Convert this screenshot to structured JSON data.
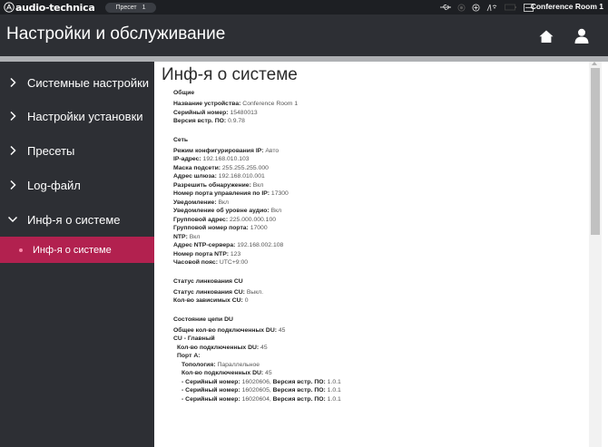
{
  "topbar": {
    "brand": "audio-technica",
    "preset_label": "Пресет",
    "preset_number": "1",
    "room_name": "Conference Room 1",
    "icons": [
      "usb-icon",
      "record-icon",
      "link-icon",
      "antenna-icon",
      "battery-icon",
      "screen-icon"
    ]
  },
  "header": {
    "title": "Настройки и обслуживание"
  },
  "sidebar": {
    "items": [
      {
        "label": "Системные настройки",
        "expanded": false
      },
      {
        "label": "Настройки установки",
        "expanded": false
      },
      {
        "label": "Пресеты",
        "expanded": false
      },
      {
        "label": "Log-файл",
        "expanded": false
      },
      {
        "label": "Инф-я о системе",
        "expanded": true
      }
    ],
    "active_sub": "Инф-я о системе"
  },
  "main": {
    "title": "Инф-я о системе",
    "general": {
      "heading": "Общие",
      "rows": [
        {
          "k": "Название устройства:",
          "v": " Conference Room 1"
        },
        {
          "k": "Серийный номер:",
          "v": " 15480013"
        },
        {
          "k": "Версия встр. ПО:",
          "v": " 0.9.78"
        }
      ]
    },
    "network": {
      "heading": "Сеть",
      "rows": [
        {
          "k": "Режим конфигурирования IP:",
          "v": " Авто"
        },
        {
          "k": "IP-адрес:",
          "v": " 192.168.010.103"
        },
        {
          "k": "Маска подсети:",
          "v": " 255.255.255.000"
        },
        {
          "k": "Адрес шлюза:",
          "v": " 192.168.010.001"
        },
        {
          "k": "Разрешить обнаружение:",
          "v": " Вкл"
        },
        {
          "k": "Номер порта управления по IP:",
          "v": " 17300"
        },
        {
          "k": "Уведомление:",
          "v": " Вкл"
        },
        {
          "k": "Уведомление об уровне аудио:",
          "v": " Вкл"
        },
        {
          "k": "Групповой адрес:",
          "v": " 225.000.000.100"
        },
        {
          "k": "Групповой номер порта:",
          "v": " 17000"
        },
        {
          "k": "NTP:",
          "v": " Вкл"
        },
        {
          "k": "Адрес NTP-сервера:",
          "v": " 192.168.002.108"
        },
        {
          "k": "Номер порта NTP:",
          "v": " 123"
        },
        {
          "k": "Часовой пояс:",
          "v": " UTC+9:00"
        }
      ]
    },
    "cu_link": {
      "heading": "Статус линкования CU",
      "rows": [
        {
          "k": "Статус линкования CU:",
          "v": " Выкл."
        },
        {
          "k": "Кол-во зависимых CU:",
          "v": " 0"
        }
      ]
    },
    "du_chain": {
      "heading": "Состояние цепи DU",
      "total": {
        "k": "Общее кол-во подключенных DU:",
        "v": " 45"
      },
      "cu_main": "CU - Главный",
      "cu_count": {
        "k": "Кол-во подключенных DU:",
        "v": " 45"
      },
      "port_a": "Порт A:",
      "topology": {
        "k": "Топология:",
        "v": " Параллельное"
      },
      "port_count": {
        "k": "Кол-во подключенных DU:",
        "v": " 45"
      },
      "serials": [
        {
          "prefix": "- ",
          "k": "Серийный номер:",
          "v": " 16020606, ",
          "k2": "Версия встр. ПО:",
          "v2": " 1.0.1"
        },
        {
          "prefix": "- ",
          "k": "Серийный номер:",
          "v": " 16020605, ",
          "k2": "Версия встр. ПО:",
          "v2": " 1.0.1"
        },
        {
          "prefix": "- ",
          "k": "Серийный номер:",
          "v": " 16020604, ",
          "k2": "Версия встр. ПО:",
          "v2": " 1.0.1"
        }
      ]
    }
  },
  "colors": {
    "topbar": "#1d1f23",
    "panel": "#2d2f34",
    "active_item": "#b2214f",
    "separator": "#aeb0b3"
  }
}
